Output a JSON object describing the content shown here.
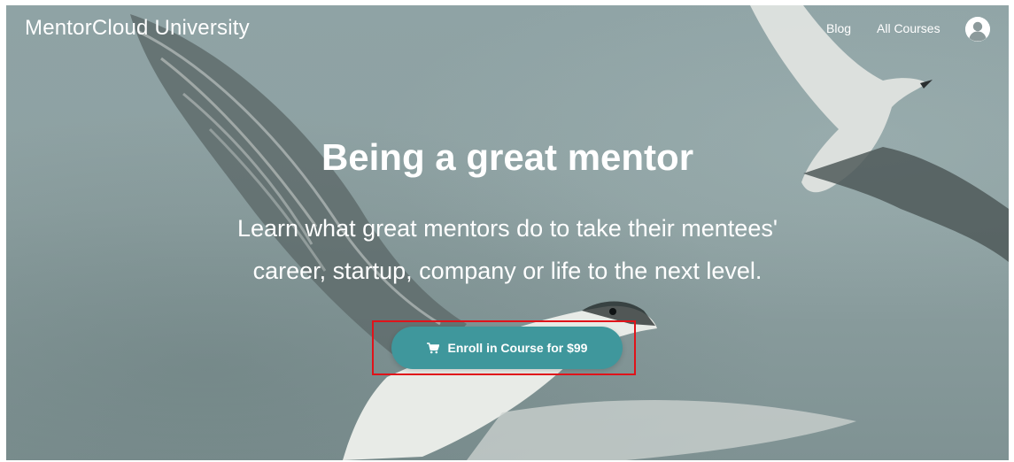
{
  "header": {
    "brand": "MentorCloud University",
    "nav": [
      {
        "label": "Blog"
      },
      {
        "label": "All Courses"
      }
    ]
  },
  "hero": {
    "title": "Being a great mentor",
    "subtitle_line1": "Learn what great mentors do to take their mentees'",
    "subtitle_line2": "career, startup, company or life to the next level.",
    "cta_label": "Enroll in Course for $99"
  },
  "icons": {
    "cart": "shopping-cart-icon",
    "avatar": "user-avatar-icon"
  },
  "colors": {
    "cta_background": "#3f979c",
    "highlight_border": "#e0131a",
    "sky": "#8fa3a5"
  }
}
